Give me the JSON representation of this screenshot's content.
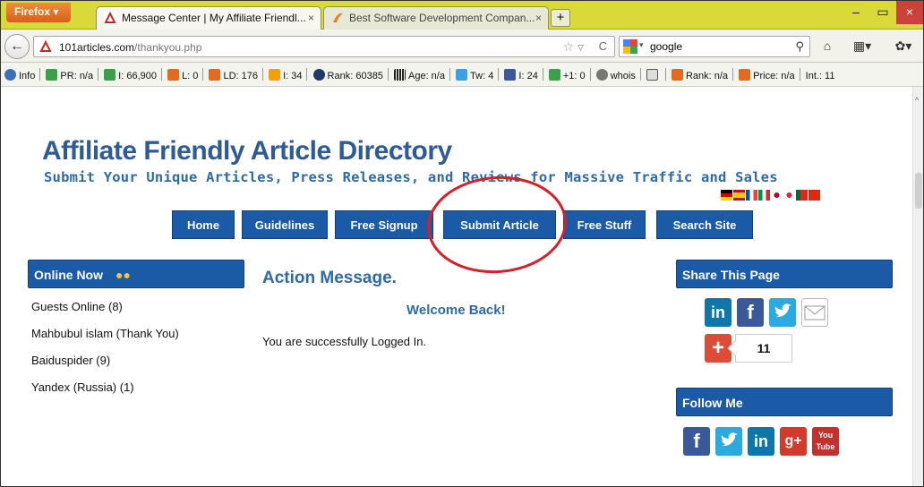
{
  "browser": {
    "menu_button": "Firefox ▾",
    "tabs": [
      {
        "label": "Message Center | My Affiliate Friendl...",
        "close": "×"
      },
      {
        "label": "Best Software Development Compan...",
        "close": "×"
      }
    ],
    "new_tab": "+",
    "window_controls": {
      "minimize": "‒",
      "maximize": "▭",
      "close": "×"
    },
    "url_host": "101articles.com",
    "url_path": "/thankyou.php",
    "search_value": "google",
    "addon_items": [
      "Info",
      "PR: n/a",
      "I: 66,900",
      "L: 0",
      "LD: 176",
      "I: 34",
      "Rank: 60385",
      "Age: n/a",
      "Tw: 4",
      "I: 24",
      "+1: 0",
      "whois",
      "",
      "Rank: n/a",
      "Price: n/a",
      "Int.: 11"
    ]
  },
  "site": {
    "title": "Affiliate Friendly Article Directory",
    "subtitle": "Submit Your Unique Articles, Press Releases, and Reviews for Massive Traffic and Sales",
    "menu": [
      "Home",
      "Guidelines",
      "Free Signup",
      "Submit Article",
      "Free Stuff",
      "Search Site"
    ]
  },
  "online_now": {
    "title": "Online Now",
    "entries": [
      "Guests Online (8)",
      "Mahbubul islam (Thank You)",
      "Baiduspider (9)",
      "Yandex (Russia) (1)"
    ]
  },
  "main": {
    "title": "Action Message.",
    "welcome": "Welcome Back!",
    "message": "You are successfully Logged In."
  },
  "share": {
    "title": "Share This Page",
    "count": "11"
  },
  "follow": {
    "title": "Follow Me"
  },
  "colors": {
    "brand_blue": "#1a5aa6",
    "title_blue": "#2e5b97",
    "highlight_red": "#d81e28",
    "titlebar_yellow": "#d9d93a"
  }
}
